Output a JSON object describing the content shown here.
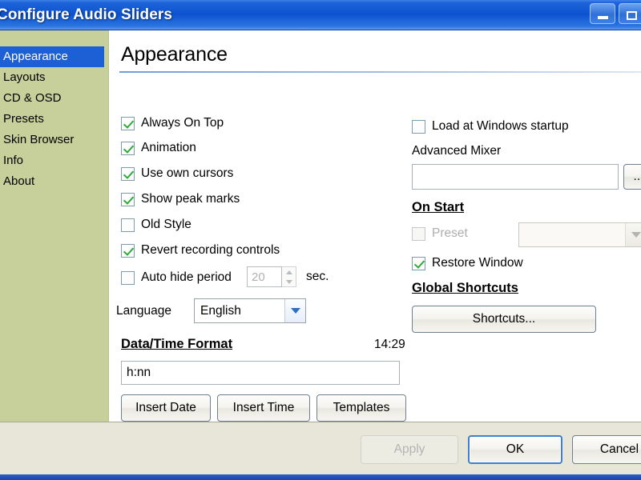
{
  "window": {
    "title": "Configure Audio Sliders",
    "minimize_label": "Minimize",
    "maximize_label": "Maximize"
  },
  "sidebar": {
    "items": [
      {
        "label": "Appearance",
        "active": true
      },
      {
        "label": "Layouts",
        "active": false
      },
      {
        "label": "CD & OSD",
        "active": false
      },
      {
        "label": "Presets",
        "active": false
      },
      {
        "label": "Skin Browser",
        "active": false
      },
      {
        "label": "Info",
        "active": false
      },
      {
        "label": "About",
        "active": false
      }
    ]
  },
  "page": {
    "title": "Appearance"
  },
  "left_column": {
    "checkboxes": [
      {
        "label": "Always On Top",
        "checked": true,
        "disabled": false
      },
      {
        "label": "Animation",
        "checked": true,
        "disabled": false
      },
      {
        "label": "Use own cursors",
        "checked": true,
        "disabled": false
      },
      {
        "label": "Show peak marks",
        "checked": true,
        "disabled": false
      },
      {
        "label": "Old Style",
        "checked": false,
        "disabled": false
      },
      {
        "label": "Revert recording controls",
        "checked": true,
        "disabled": false
      },
      {
        "label": "Auto hide period",
        "checked": false,
        "disabled": false
      }
    ],
    "auto_hide": {
      "value": "20",
      "unit_label": "sec."
    },
    "language": {
      "label": "Language",
      "value": "English"
    },
    "datetime": {
      "heading": "Data/Time Format",
      "preview": "14:29",
      "format_value": "h:nn",
      "insert_date_label": "Insert Date",
      "insert_time_label": "Insert Time",
      "templates_label": "Templates"
    }
  },
  "right_column": {
    "startup_checkbox": {
      "label": "Load at Windows startup",
      "checked": false
    },
    "advanced_mixer": {
      "label": "Advanced Mixer",
      "value": "",
      "browse_label": "..."
    },
    "on_start": {
      "heading": "On Start",
      "preset_label": "Preset",
      "preset_value": "",
      "restore_window_label": "Restore Window"
    },
    "global_shortcuts": {
      "heading": "Global Shortcuts",
      "button_label": "Shortcuts..."
    }
  },
  "footer": {
    "apply_label": "Apply",
    "ok_label": "OK",
    "cancel_label": "Cancel"
  }
}
